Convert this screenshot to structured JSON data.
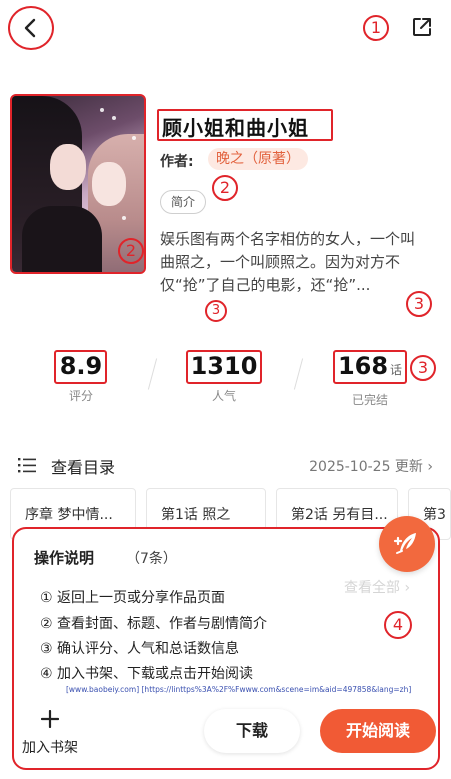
{
  "header": {
    "back_icon": "chevron-left-icon",
    "share_icon": "share-external-icon",
    "annotation": "1"
  },
  "book": {
    "title": "顾小姐和曲小姐",
    "author_label": "作者:",
    "author_name": "晚之（原著）",
    "intro_tag": "简介",
    "synopsis": "娱乐图有两个名字相仿的女人，一个叫曲照之，一个叫顾照之。因为对方不仅“抢”了自己的电影，还“抢”...",
    "cover_annotation": "2",
    "title_annotation": "2",
    "synopsis_annotation_a": "3",
    "synopsis_annotation_b": "3"
  },
  "stats": {
    "rating": {
      "value": "8.9",
      "label": "评分"
    },
    "popularity": {
      "value": "1310",
      "label": "人气"
    },
    "episodes": {
      "value": "168",
      "unit": "话",
      "label": "已完结"
    },
    "annotation": "3"
  },
  "catalog": {
    "icon": "list-icon",
    "title": "查看目录",
    "update_text": "2025-10-25 更新 ›",
    "chapters": [
      "序章  梦中情...",
      "第1话  照之",
      "第2话  另有目...",
      "第3"
    ]
  },
  "panel": {
    "title": "操作说明",
    "count": "（7条）",
    "view_all": "查看全部 ›",
    "annotation": "4",
    "steps": [
      "① 返回上一页或分享作品页面",
      "② 查看封面、标题、作者与剧情简介",
      "③ 确认评分、人气和总话数信息",
      "④ 加入书架、下载或点击开始阅读"
    ],
    "watermark": "[www.baobeiy.com] [https://linttps%3A%2F%Fwww.com&scene=im&aid=497858&lang=zh]",
    "fab_icon": "quill-pen-icon"
  },
  "bottom_bar": {
    "add_shelf_icon": "plus-icon",
    "add_shelf_label": "加入书架",
    "download_label": "下载",
    "read_label": "开始阅读"
  },
  "colors": {
    "accent": "#f15a35",
    "annotation_red": "#e0242a",
    "author_bg": "#fde9e2",
    "author_text": "#e2623e"
  }
}
